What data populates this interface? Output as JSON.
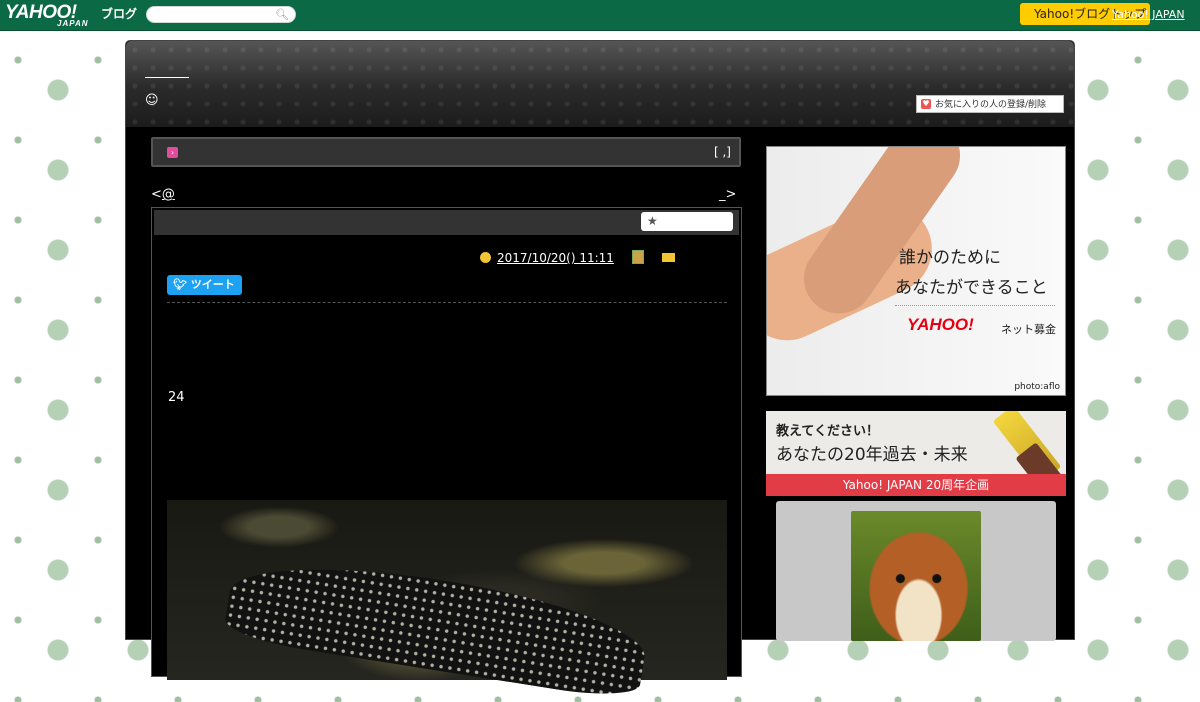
{
  "topbar": {
    "logo_text": "YAHOO!",
    "logo_sub": "JAPAN",
    "logo_blog": "ブログ",
    "search_placeholder": "",
    "yahoo_button": "Yahoo!ブログトップ",
    "yahoo_japan_link": "Yahoo! JAPAN"
  },
  "header": {
    "blog_title": "",
    "face_icon": "☺",
    "fav_button": "お気に入りの人の登録/削除"
  },
  "category_bar": {
    "label": "",
    "brackets": "[ ,]"
  },
  "nav": {
    "prev_prefix": "<",
    "prev_link": "@",
    "next_text": "_>"
  },
  "article": {
    "star_icon": "★",
    "date": "2017/10/20()  11:11",
    "date_suffix": "",
    "category_link": "",
    "tweet_label": "ツイート",
    "body_number": "24"
  },
  "ads": {
    "ad1_line1": "誰かのために",
    "ad1_line2": "あなたができること",
    "ad1_logo": "YAHOO!",
    "ad1_logo_sub": "ネット募金",
    "ad1_credit": "photo:aflo",
    "ad2_line1": "教えてください！",
    "ad2_line2": "あなたの20年過去・未来",
    "ad2_band": "Yahoo! JAPAN 20周年企画"
  },
  "colors": {
    "topbar": "#0b6a45",
    "accent_yellow": "#ffcc00",
    "tweet_blue": "#1da1f2",
    "ad_red": "#e23c46"
  }
}
